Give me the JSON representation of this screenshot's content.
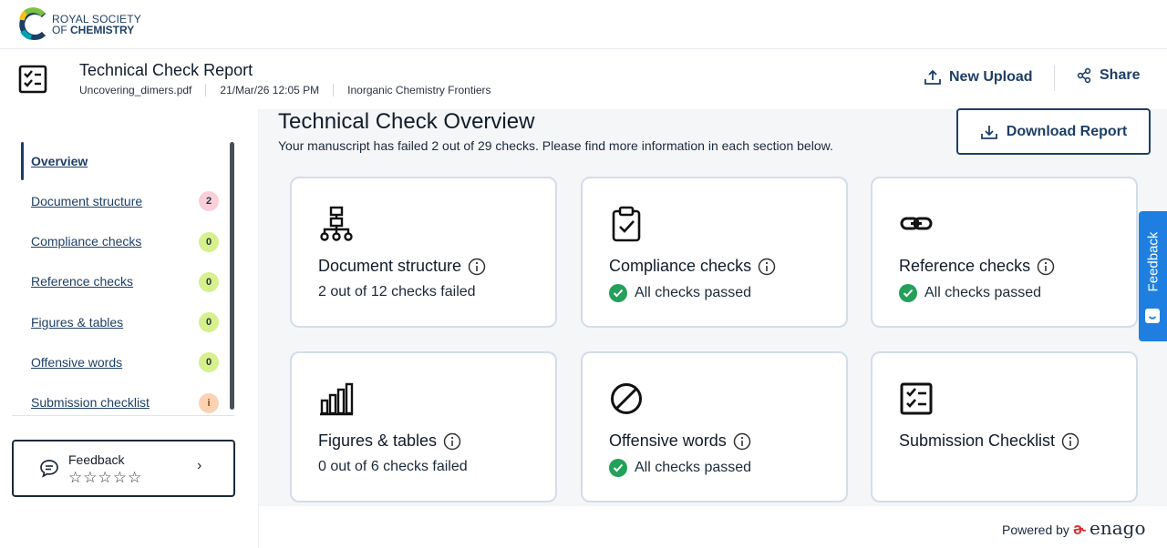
{
  "brand": {
    "line1": "ROYAL SOCIETY",
    "line2_prefix": "OF",
    "line2_bold": "CHEMISTRY"
  },
  "report": {
    "title": "Technical Check Report",
    "filename": "Uncovering_dimers.pdf",
    "datetime": "21/Mar/26 12:05 PM",
    "journal": "Inorganic Chemistry Frontiers"
  },
  "header_actions": {
    "new_upload": "New Upload",
    "share": "Share"
  },
  "sidebar": {
    "items": [
      {
        "label": "Overview",
        "badge": ""
      },
      {
        "label": "Document structure",
        "badge": "2",
        "badge_color": "#f9cfd9"
      },
      {
        "label": "Compliance checks",
        "badge": "0",
        "badge_color": "#d6f08c"
      },
      {
        "label": "Reference checks",
        "badge": "0",
        "badge_color": "#d6f08c"
      },
      {
        "label": "Figures & tables",
        "badge": "0",
        "badge_color": "#d6f08c"
      },
      {
        "label": "Offensive words",
        "badge": "0",
        "badge_color": "#d6f08c"
      },
      {
        "label": "Submission checklist",
        "badge": "i",
        "badge_color": "#fbd3b3"
      }
    ],
    "feedback": {
      "title": "Feedback",
      "stars": "☆☆☆☆☆",
      "chevron": "›"
    }
  },
  "overview": {
    "title": "Technical Check Overview",
    "subtitle": "Your manuscript has failed 2 out of 29 checks. Please find more information in each section below.",
    "download_label": "Download Report"
  },
  "cards": [
    {
      "icon": "hierarchy-icon",
      "title": "Document structure",
      "status": "2 out of 12 checks failed",
      "passed": false
    },
    {
      "icon": "clipboard-check-icon",
      "title": "Compliance checks",
      "status": "All checks passed",
      "passed": true
    },
    {
      "icon": "link-icon",
      "title": "Reference checks",
      "status": "All checks passed",
      "passed": true
    },
    {
      "icon": "bar-chart-icon",
      "title": "Figures & tables",
      "status": "0 out of 6 checks failed",
      "passed": false
    },
    {
      "icon": "prohibited-icon",
      "title": "Offensive words",
      "status": "All checks passed",
      "passed": true
    },
    {
      "icon": "checklist-icon",
      "title": "Submission Checklist",
      "status": "",
      "passed": false
    }
  ],
  "feedback_tab": "Feedback",
  "footer": {
    "powered_by": "Powered by",
    "brand": "enago"
  },
  "colors": {
    "brand_navy": "#1d3f66",
    "success_green": "#23a05a",
    "feedback_blue": "#1f7fe0"
  }
}
